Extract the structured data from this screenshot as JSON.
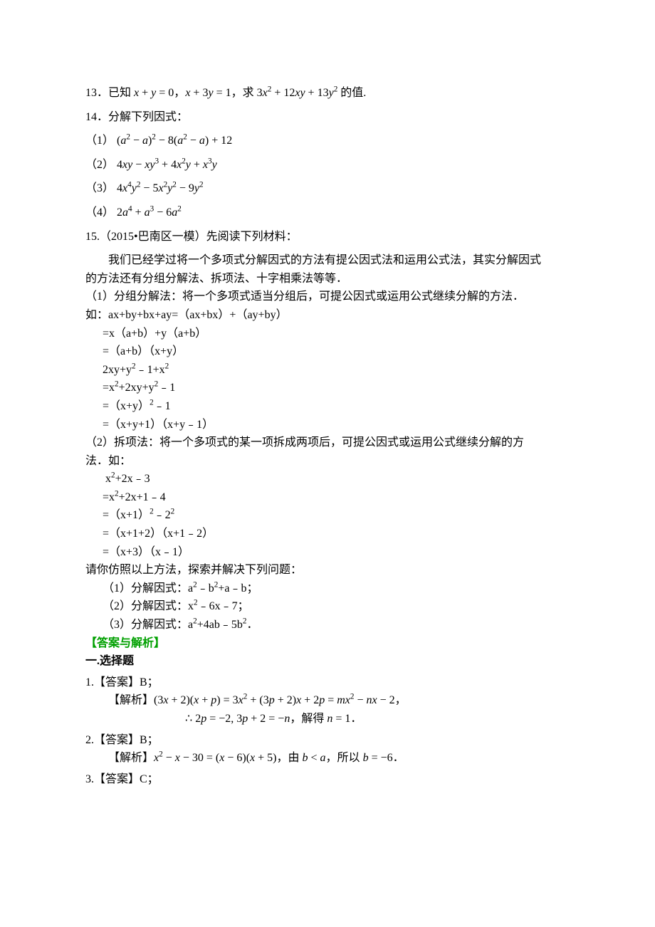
{
  "q13": {
    "prefix": "13．已知 ",
    "eq1a": "x",
    "eq1b": " + ",
    "eq1c": "y",
    "eq1d": " = 0",
    "sep1": "，",
    "eq2a": "x",
    "eq2b": " + 3",
    "eq2c": "y",
    "eq2d": " = 1",
    "sep2": "，求 ",
    "eq3": "3x² + 12xy + 13y²",
    "suffix": " 的值."
  },
  "q14": {
    "title": "14．分解下列因式：",
    "p1_label": "（1）",
    "p1_expr": "(a² − a)² − 8(a² − a) + 12",
    "p2_label": "（2）",
    "p2_expr": "4xy − xy³ + 4x²y + x³y",
    "p3_label": "（3）",
    "p3_expr": "4x⁴y² − 5x²y² − 9y²",
    "p4_label": "（4）",
    "p4_expr": "2a⁴ + a³ − 6a²"
  },
  "q15": {
    "title": "15.（2015•巴南区一模）先阅读下列材料：",
    "intro1": "我们已经学过将一个多项式分解因式的方法有提公因式法和运用公式法，其实分解因式",
    "intro2": "的方法还有分组分解法、拆项法、十字相乘法等等．",
    "m1_head": "（1）分组分解法：将一个多项式适当分组后，可提公因式或运用公式继续分解的方法．",
    "m1_l0": "如：ax+by+bx+ay=（ax+bx）+（ay+by）",
    "m1_l1": "=x（a+b）+y（a+b）",
    "m1_l2": "=（a+b）（x+y）",
    "m1_l3": "2xy+y²﹣1+x²",
    "m1_l4": "=x²+2xy+y²﹣1",
    "m1_l5": "=（x+y）²﹣1",
    "m1_l6": "=（x+y+1）（x+y﹣1）",
    "m2_head1": "（2）拆项法：将一个多项式的某一项拆成两项后，可提公因式或运用公式继续分解的方",
    "m2_head2": "法．如：",
    "m2_l0": "x²+2x﹣3",
    "m2_l1": "=x²+2x+1﹣4",
    "m2_l2": "=（x+1）²﹣2²",
    "m2_l3": "=（x+1+2）（x+1﹣2）",
    "m2_l4": "=（x+3）（x﹣1）",
    "task": "请你仿照以上方法，探索并解决下列问题：",
    "t1": "（1）分解因式：a²﹣b²+a﹣b；",
    "t2": "（2）分解因式：x²﹣6x﹣7；",
    "t3": "（3）分解因式：a²+4ab﹣5b²．"
  },
  "answers": {
    "heading": "【答案与解析】",
    "section": "一.选择题",
    "a1_label": "1.【答案】B；",
    "a1_expl_label": "【解析】",
    "a1_expr1": "(3x + 2)(x + p) = 3x² + (3p + 2)x + 2p = mx² − nx − 2",
    "a1_sep": "，",
    "a1_line2_pre": "∴ ",
    "a1_line2_a": "2p = −2, 3p + 2 = −n",
    "a1_line2_mid": "，解得 ",
    "a1_line2_b": "n = 1",
    "a1_line2_end": "．",
    "a2_label": "2.【答案】B；",
    "a2_expl_label": "【解析】",
    "a2_expr": "x² − x − 30 = (x − 6)(x + 5)",
    "a2_mid1": "，由 ",
    "a2_cond": "b < a",
    "a2_mid2": "，所以 ",
    "a2_res": "b = −6",
    "a2_end": "．",
    "a3_label": "3.【答案】C；"
  }
}
